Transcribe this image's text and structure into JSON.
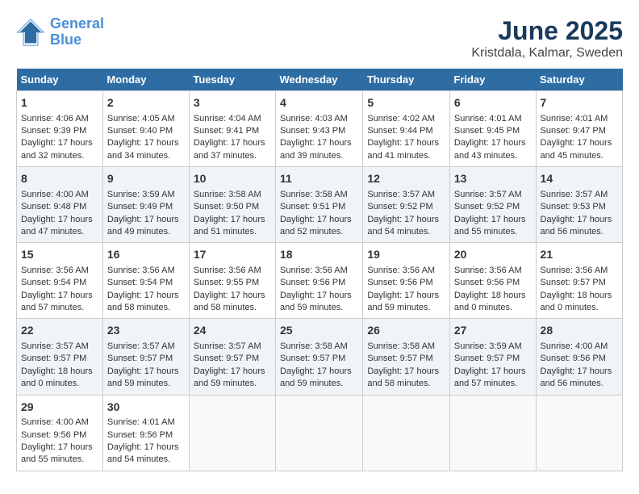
{
  "logo": {
    "line1": "General",
    "line2": "Blue"
  },
  "title": "June 2025",
  "subtitle": "Kristdala, Kalmar, Sweden",
  "days_of_week": [
    "Sunday",
    "Monday",
    "Tuesday",
    "Wednesday",
    "Thursday",
    "Friday",
    "Saturday"
  ],
  "weeks": [
    [
      {
        "day": 1,
        "sunrise": "Sunrise: 4:06 AM",
        "sunset": "Sunset: 9:39 PM",
        "daylight": "Daylight: 17 hours and 32 minutes."
      },
      {
        "day": 2,
        "sunrise": "Sunrise: 4:05 AM",
        "sunset": "Sunset: 9:40 PM",
        "daylight": "Daylight: 17 hours and 34 minutes."
      },
      {
        "day": 3,
        "sunrise": "Sunrise: 4:04 AM",
        "sunset": "Sunset: 9:41 PM",
        "daylight": "Daylight: 17 hours and 37 minutes."
      },
      {
        "day": 4,
        "sunrise": "Sunrise: 4:03 AM",
        "sunset": "Sunset: 9:43 PM",
        "daylight": "Daylight: 17 hours and 39 minutes."
      },
      {
        "day": 5,
        "sunrise": "Sunrise: 4:02 AM",
        "sunset": "Sunset: 9:44 PM",
        "daylight": "Daylight: 17 hours and 41 minutes."
      },
      {
        "day": 6,
        "sunrise": "Sunrise: 4:01 AM",
        "sunset": "Sunset: 9:45 PM",
        "daylight": "Daylight: 17 hours and 43 minutes."
      },
      {
        "day": 7,
        "sunrise": "Sunrise: 4:01 AM",
        "sunset": "Sunset: 9:47 PM",
        "daylight": "Daylight: 17 hours and 45 minutes."
      }
    ],
    [
      {
        "day": 8,
        "sunrise": "Sunrise: 4:00 AM",
        "sunset": "Sunset: 9:48 PM",
        "daylight": "Daylight: 17 hours and 47 minutes."
      },
      {
        "day": 9,
        "sunrise": "Sunrise: 3:59 AM",
        "sunset": "Sunset: 9:49 PM",
        "daylight": "Daylight: 17 hours and 49 minutes."
      },
      {
        "day": 10,
        "sunrise": "Sunrise: 3:58 AM",
        "sunset": "Sunset: 9:50 PM",
        "daylight": "Daylight: 17 hours and 51 minutes."
      },
      {
        "day": 11,
        "sunrise": "Sunrise: 3:58 AM",
        "sunset": "Sunset: 9:51 PM",
        "daylight": "Daylight: 17 hours and 52 minutes."
      },
      {
        "day": 12,
        "sunrise": "Sunrise: 3:57 AM",
        "sunset": "Sunset: 9:52 PM",
        "daylight": "Daylight: 17 hours and 54 minutes."
      },
      {
        "day": 13,
        "sunrise": "Sunrise: 3:57 AM",
        "sunset": "Sunset: 9:52 PM",
        "daylight": "Daylight: 17 hours and 55 minutes."
      },
      {
        "day": 14,
        "sunrise": "Sunrise: 3:57 AM",
        "sunset": "Sunset: 9:53 PM",
        "daylight": "Daylight: 17 hours and 56 minutes."
      }
    ],
    [
      {
        "day": 15,
        "sunrise": "Sunrise: 3:56 AM",
        "sunset": "Sunset: 9:54 PM",
        "daylight": "Daylight: 17 hours and 57 minutes."
      },
      {
        "day": 16,
        "sunrise": "Sunrise: 3:56 AM",
        "sunset": "Sunset: 9:54 PM",
        "daylight": "Daylight: 17 hours and 58 minutes."
      },
      {
        "day": 17,
        "sunrise": "Sunrise: 3:56 AM",
        "sunset": "Sunset: 9:55 PM",
        "daylight": "Daylight: 17 hours and 58 minutes."
      },
      {
        "day": 18,
        "sunrise": "Sunrise: 3:56 AM",
        "sunset": "Sunset: 9:56 PM",
        "daylight": "Daylight: 17 hours and 59 minutes."
      },
      {
        "day": 19,
        "sunrise": "Sunrise: 3:56 AM",
        "sunset": "Sunset: 9:56 PM",
        "daylight": "Daylight: 17 hours and 59 minutes."
      },
      {
        "day": 20,
        "sunrise": "Sunrise: 3:56 AM",
        "sunset": "Sunset: 9:56 PM",
        "daylight": "Daylight: 18 hours and 0 minutes."
      },
      {
        "day": 21,
        "sunrise": "Sunrise: 3:56 AM",
        "sunset": "Sunset: 9:57 PM",
        "daylight": "Daylight: 18 hours and 0 minutes."
      }
    ],
    [
      {
        "day": 22,
        "sunrise": "Sunrise: 3:57 AM",
        "sunset": "Sunset: 9:57 PM",
        "daylight": "Daylight: 18 hours and 0 minutes."
      },
      {
        "day": 23,
        "sunrise": "Sunrise: 3:57 AM",
        "sunset": "Sunset: 9:57 PM",
        "daylight": "Daylight: 17 hours and 59 minutes."
      },
      {
        "day": 24,
        "sunrise": "Sunrise: 3:57 AM",
        "sunset": "Sunset: 9:57 PM",
        "daylight": "Daylight: 17 hours and 59 minutes."
      },
      {
        "day": 25,
        "sunrise": "Sunrise: 3:58 AM",
        "sunset": "Sunset: 9:57 PM",
        "daylight": "Daylight: 17 hours and 59 minutes."
      },
      {
        "day": 26,
        "sunrise": "Sunrise: 3:58 AM",
        "sunset": "Sunset: 9:57 PM",
        "daylight": "Daylight: 17 hours and 58 minutes."
      },
      {
        "day": 27,
        "sunrise": "Sunrise: 3:59 AM",
        "sunset": "Sunset: 9:57 PM",
        "daylight": "Daylight: 17 hours and 57 minutes."
      },
      {
        "day": 28,
        "sunrise": "Sunrise: 4:00 AM",
        "sunset": "Sunset: 9:56 PM",
        "daylight": "Daylight: 17 hours and 56 minutes."
      }
    ],
    [
      {
        "day": 29,
        "sunrise": "Sunrise: 4:00 AM",
        "sunset": "Sunset: 9:56 PM",
        "daylight": "Daylight: 17 hours and 55 minutes."
      },
      {
        "day": 30,
        "sunrise": "Sunrise: 4:01 AM",
        "sunset": "Sunset: 9:56 PM",
        "daylight": "Daylight: 17 hours and 54 minutes."
      },
      null,
      null,
      null,
      null,
      null
    ]
  ]
}
